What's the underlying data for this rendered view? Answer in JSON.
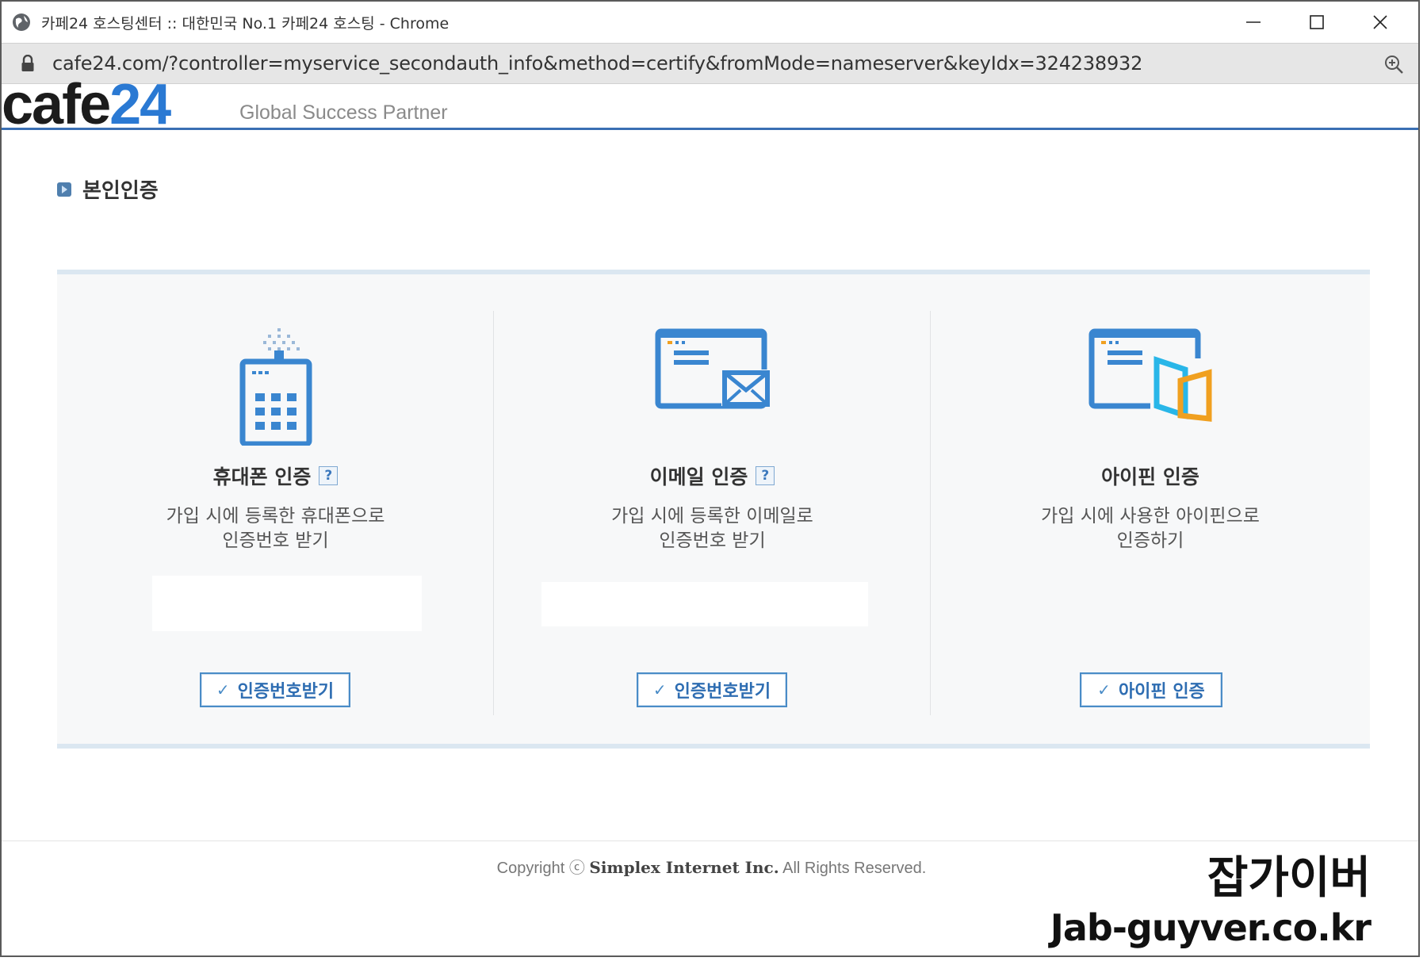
{
  "browser": {
    "title": "카페24 호스팅센터 :: 대한민국 No.1 카페24 호스팅 - Chrome",
    "url": "cafe24.com/?controller=myservice_secondauth_info&method=certify&fromMode=nameserver&keyIdx=324238932"
  },
  "header": {
    "logo_text": "cafe",
    "logo_number": "24",
    "tagline": "Global Success Partner"
  },
  "page": {
    "title": "본인인증"
  },
  "auth_options": [
    {
      "title": "휴대폰 인증",
      "help": "?",
      "desc_line1": "가입 시에 등록한 휴대폰으로",
      "desc_line2": "인증번호 받기",
      "button_check": "✓",
      "button_label": "인증번호받기",
      "icon": "mobile-phone-icon"
    },
    {
      "title": "이메일 인증",
      "help": "?",
      "desc_line1": "가입 시에 등록한 이메일로",
      "desc_line2": "인증번호 받기",
      "button_check": "✓",
      "button_label": "인증번호받기",
      "icon": "email-envelope-icon"
    },
    {
      "title": "아이핀 인증",
      "desc_line1": "가입 시에 사용한 아이핀으로",
      "desc_line2": "인증하기",
      "button_check": "✓",
      "button_label": "아이핀 인증",
      "icon": "ipin-icon"
    }
  ],
  "footer": {
    "copyright_prefix": "Copyright ⓒ",
    "company": "Simplex Internet Inc.",
    "rights": "All Rights Reserved."
  },
  "watermark": {
    "korean": "잡가이버",
    "site": "Jab-guyver.co.kr"
  },
  "colors": {
    "accent_blue": "#2a79d3",
    "header_rule": "#3a6fb3",
    "button_border": "#4a8cc7",
    "ipin_orange": "#f0a020",
    "ipin_cyan": "#29b6e8"
  }
}
